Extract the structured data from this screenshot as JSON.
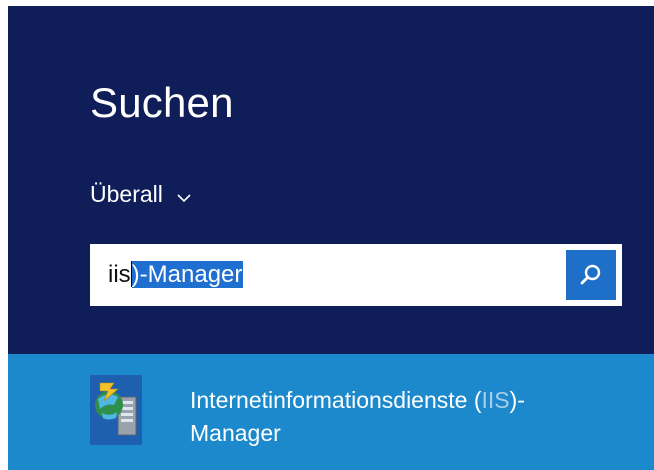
{
  "search_pane": {
    "title": "Suchen",
    "scope": {
      "label": "Überall"
    },
    "search": {
      "typed_text": "iis",
      "autocomplete_selected": ")-Manager"
    },
    "results": [
      {
        "label_prefix": "Internetinformationsdienste (",
        "label_match": "IIS",
        "label_suffix": ")-",
        "label_line2": "Manager",
        "icon": "iis-manager-icon"
      }
    ],
    "colors": {
      "pane_background": "#0f1d59",
      "result_highlight": "#1c89cd",
      "search_button": "#1e6fc8",
      "selection": "#1f6fd1"
    }
  }
}
